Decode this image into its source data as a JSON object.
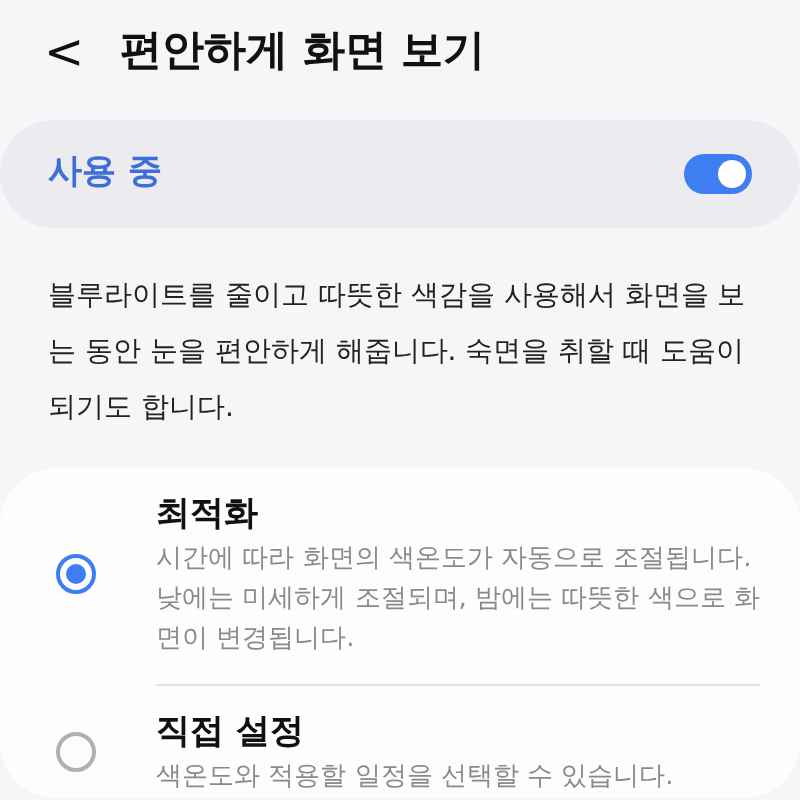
{
  "header": {
    "back": "<",
    "title": "편안하게 화면 보기"
  },
  "master": {
    "label": "사용 중",
    "on": true
  },
  "description": "블루라이트를 줄이고 따뜻한 색감을 사용해서 화면을 보는 동안 눈을 편안하게 해줍니다. 숙면을 취할 때 도움이 되기도 합니다.",
  "options": [
    {
      "title": "최적화",
      "description": "시간에 따라 화면의 색온도가 자동으로 조절됩니다. 낮에는 미세하게 조절되며, 밤에는 따뜻한 색으로 화면이 변경됩니다.",
      "selected": true
    },
    {
      "title": "직접 설정",
      "description": "색온도와 적용할 일정을 선택할 수 있습니다.",
      "selected": false
    }
  ]
}
